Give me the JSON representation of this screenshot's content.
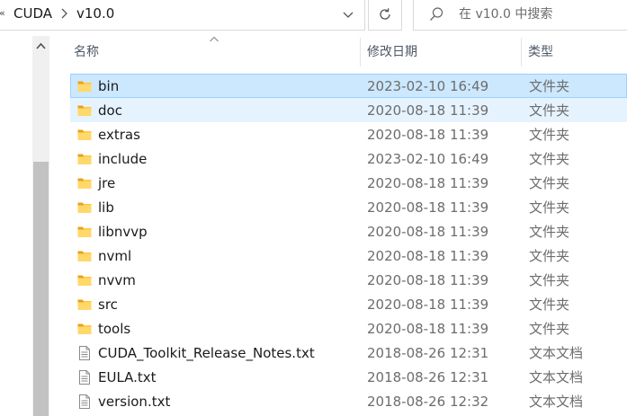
{
  "address_bar": {
    "leading_glyph": "«",
    "breadcrumbs": [
      "CUDA",
      "v10.0"
    ]
  },
  "search": {
    "placeholder": "在 v10.0 中搜索"
  },
  "columns": {
    "name": "名称",
    "date_modified": "修改日期",
    "type": "类型"
  },
  "files": [
    {
      "name": "bin",
      "date": "2023-02-10 16:49",
      "type": "文件夹",
      "icon": "folder-icon",
      "state": "selected"
    },
    {
      "name": "doc",
      "date": "2020-08-18 11:39",
      "type": "文件夹",
      "icon": "folder-icon",
      "state": "hover"
    },
    {
      "name": "extras",
      "date": "2020-08-18 11:39",
      "type": "文件夹",
      "icon": "folder-icon",
      "state": ""
    },
    {
      "name": "include",
      "date": "2023-02-10 16:49",
      "type": "文件夹",
      "icon": "folder-icon",
      "state": ""
    },
    {
      "name": "jre",
      "date": "2020-08-18 11:39",
      "type": "文件夹",
      "icon": "folder-icon",
      "state": ""
    },
    {
      "name": "lib",
      "date": "2020-08-18 11:39",
      "type": "文件夹",
      "icon": "folder-icon",
      "state": ""
    },
    {
      "name": "libnvvp",
      "date": "2020-08-18 11:39",
      "type": "文件夹",
      "icon": "folder-icon",
      "state": ""
    },
    {
      "name": "nvml",
      "date": "2020-08-18 11:39",
      "type": "文件夹",
      "icon": "folder-icon",
      "state": ""
    },
    {
      "name": "nvvm",
      "date": "2020-08-18 11:39",
      "type": "文件夹",
      "icon": "folder-icon",
      "state": ""
    },
    {
      "name": "src",
      "date": "2020-08-18 11:39",
      "type": "文件夹",
      "icon": "folder-icon",
      "state": ""
    },
    {
      "name": "tools",
      "date": "2020-08-18 11:39",
      "type": "文件夹",
      "icon": "folder-icon",
      "state": ""
    },
    {
      "name": "CUDA_Toolkit_Release_Notes.txt",
      "date": "2018-08-26 12:31",
      "type": "文本文档",
      "icon": "text-file-icon",
      "state": ""
    },
    {
      "name": "EULA.txt",
      "date": "2018-08-26 12:31",
      "type": "文本文档",
      "icon": "text-file-icon",
      "state": ""
    },
    {
      "name": "version.txt",
      "date": "2018-08-26 12:32",
      "type": "文本文档",
      "icon": "text-file-icon",
      "state": ""
    }
  ],
  "colors": {
    "selected_bg": "#cce8ff",
    "selected_border": "#99d1ff",
    "hover_bg": "#e5f3ff",
    "folder_yellow": "#ffc83d"
  }
}
